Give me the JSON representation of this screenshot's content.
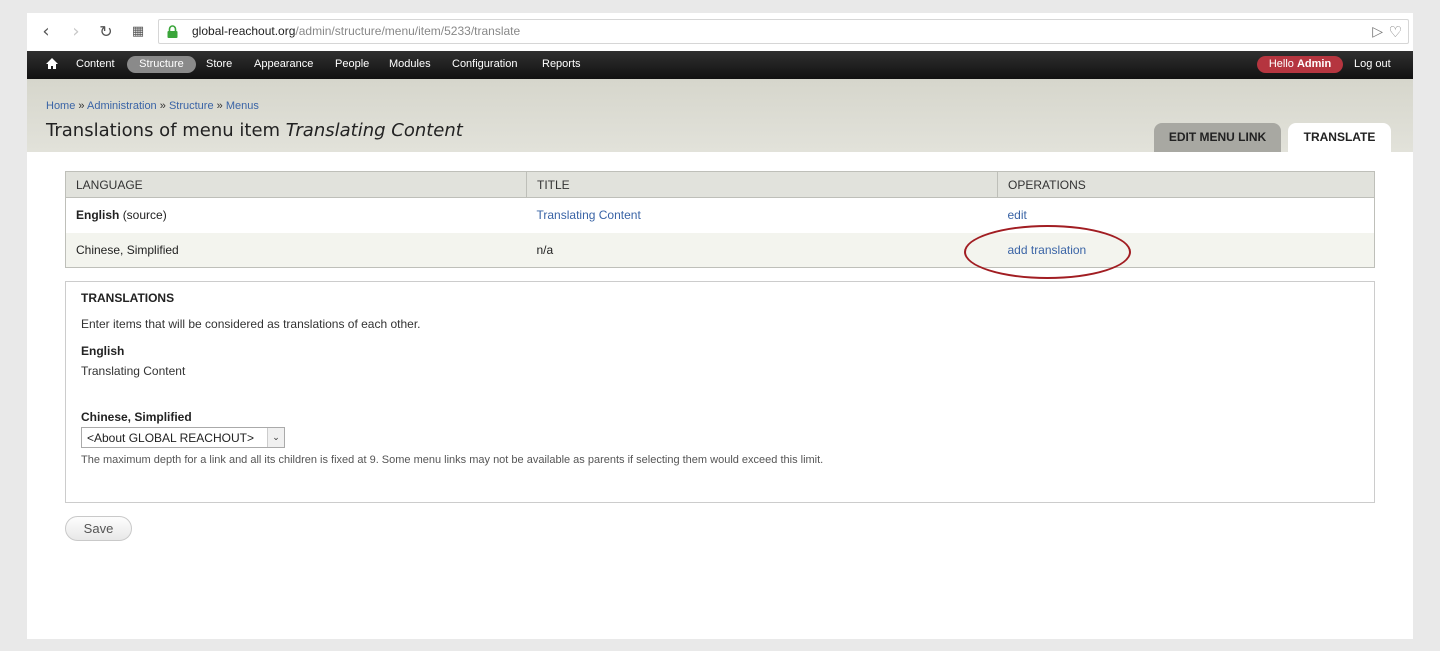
{
  "browser": {
    "url_host": "global-reachout.org",
    "url_path": "/admin/structure/menu/item/5233/translate"
  },
  "toolbar": {
    "items": [
      "Content",
      "Structure",
      "Store",
      "Appearance",
      "People",
      "Modules",
      "Configuration",
      "Reports"
    ],
    "active": "Structure",
    "hello_prefix": "Hello",
    "hello_user": "Admin",
    "logout": "Log out"
  },
  "breadcrumb": {
    "items": [
      "Home",
      "Administration",
      "Structure",
      "Menus"
    ],
    "separator": "»"
  },
  "page": {
    "title_prefix": "Translations of menu item",
    "title_item": "Translating Content"
  },
  "tabs": {
    "edit": "EDIT MENU LINK",
    "translate": "TRANSLATE"
  },
  "table": {
    "headers": [
      "LANGUAGE",
      "TITLE",
      "OPERATIONS"
    ],
    "rows": [
      {
        "language": "English",
        "language_note": "(source)",
        "title": "Translating Content",
        "operation": "edit"
      },
      {
        "language": "Chinese, Simplified",
        "language_note": "",
        "title": "n/a",
        "operation": "add translation"
      }
    ]
  },
  "translations": {
    "legend": "TRANSLATIONS",
    "description": "Enter items that will be considered as translations of each other.",
    "english_label": "English",
    "english_value": "Translating Content",
    "chinese_label": "Chinese, Simplified",
    "chinese_select_value": "<About GLOBAL REACHOUT>",
    "help": "The maximum depth for a link and all its children is fixed at 9. Some menu links may not be available as parents if selecting them would exceed this limit."
  },
  "save_label": "Save",
  "colors": {
    "link": "#3a64a6",
    "highlight": "#a11d22",
    "hello_badge": "#b5353f"
  }
}
